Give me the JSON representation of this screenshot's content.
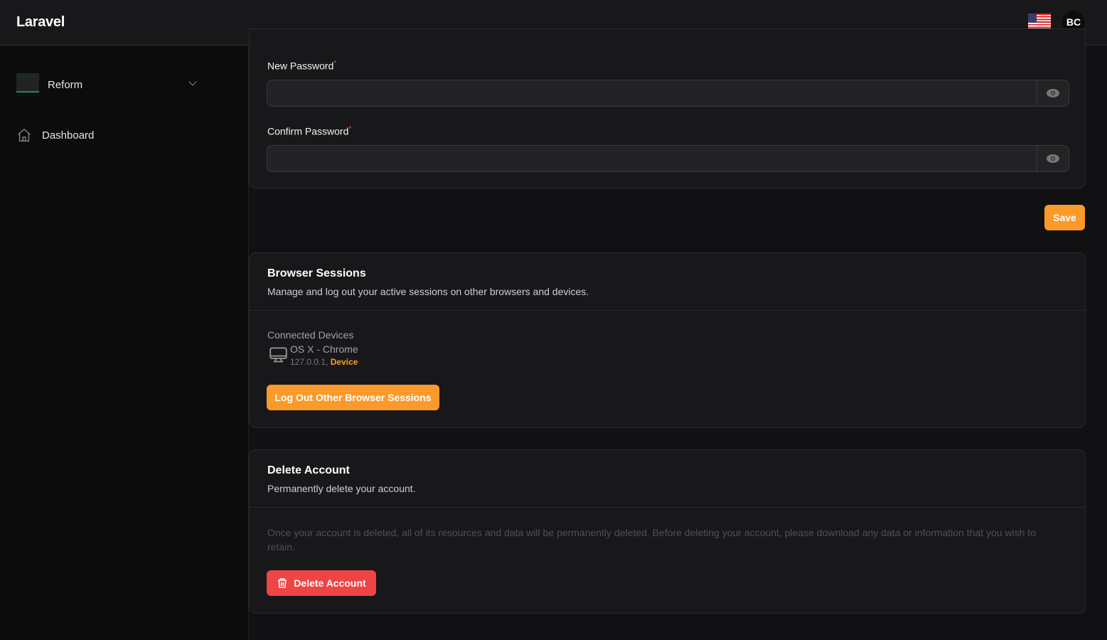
{
  "header": {
    "logo": "Laravel",
    "avatar_initials": "BC",
    "flag_icon": "us-flag-icon"
  },
  "sidebar": {
    "team": "Reform",
    "items": [
      {
        "label": "Dashboard",
        "icon": "home-icon"
      }
    ]
  },
  "password": {
    "new_label": "New Password",
    "confirm_label": "Confirm Password",
    "required_mark": "*",
    "new_value": "",
    "confirm_value": "",
    "save": "Save"
  },
  "sessions": {
    "title": "Browser Sessions",
    "description": "Manage and log out your active sessions on other browsers and devices.",
    "connected_label": "Connected Devices",
    "devices": [
      {
        "name": "OS X - Chrome",
        "ip": "127.0.0.1,",
        "tag": "Device"
      }
    ],
    "logout_button": "Log Out Other Browser Sessions"
  },
  "delete": {
    "title": "Delete Account",
    "description": "Permanently delete your account.",
    "warning": "Once your account is deleted, all of its resources and data will be permanently deleted. Before deleting your account, please download any data or information that you wish to retain.",
    "button": "Delete Account"
  },
  "colors": {
    "accent": "#fb9a2b",
    "danger": "#ef4444"
  }
}
